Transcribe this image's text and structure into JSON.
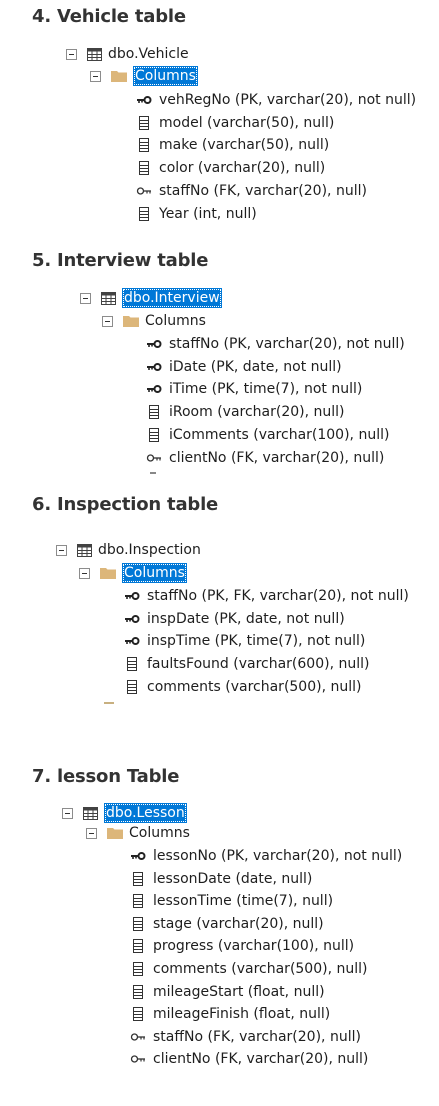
{
  "sections": [
    {
      "heading": "4. Vehicle table",
      "table_label": "dbo.Vehicle",
      "folder_label": "Columns",
      "columns": [
        {
          "icon": "primary-key-icon",
          "label": "vehRegNo (PK, varchar(20), not null)"
        },
        {
          "icon": "column-icon",
          "label": "model (varchar(50), null)"
        },
        {
          "icon": "column-icon",
          "label": "make (varchar(50), null)"
        },
        {
          "icon": "column-icon",
          "label": "color (varchar(20), null)"
        },
        {
          "icon": "foreign-key-icon",
          "label": "staffNo (FK, varchar(20), null)"
        },
        {
          "icon": "column-icon",
          "label": "Year (int, null)"
        }
      ]
    },
    {
      "heading": "5. Interview table",
      "table_label": "dbo.Interview",
      "folder_label": "Columns",
      "columns": [
        {
          "icon": "primary-key-icon",
          "label": "staffNo (PK, varchar(20), not null)"
        },
        {
          "icon": "primary-key-icon",
          "label": "iDate (PK, date, not null)"
        },
        {
          "icon": "primary-key-icon",
          "label": "iTime (PK, time(7), not null)"
        },
        {
          "icon": "column-icon",
          "label": "iRoom (varchar(20), null)"
        },
        {
          "icon": "column-icon",
          "label": "iComments (varchar(100), null)"
        },
        {
          "icon": "foreign-key-icon",
          "label": "clientNo (FK, varchar(20), null)"
        }
      ]
    },
    {
      "heading": "6. Inspection table",
      "table_label": "dbo.Inspection",
      "folder_label": "Columns",
      "columns": [
        {
          "icon": "primary-key-icon",
          "label": "staffNo (PK, FK, varchar(20), not null)"
        },
        {
          "icon": "primary-key-icon",
          "label": "inspDate (PK, date, not null)"
        },
        {
          "icon": "primary-key-icon",
          "label": "inspTime (PK, time(7), not null)"
        },
        {
          "icon": "column-icon",
          "label": "faultsFound (varchar(600), null)"
        },
        {
          "icon": "column-icon",
          "label": "comments (varchar(500), null)"
        }
      ]
    },
    {
      "heading": "7. lesson Table",
      "table_label": "dbo.Lesson",
      "folder_label": "Columns",
      "columns": [
        {
          "icon": "primary-key-icon",
          "label": "lessonNo (PK, varchar(20), not null)"
        },
        {
          "icon": "column-icon",
          "label": "lessonDate (date, null)"
        },
        {
          "icon": "column-icon",
          "label": "lessonTime (time(7), null)"
        },
        {
          "icon": "column-icon",
          "label": "stage (varchar(20), null)"
        },
        {
          "icon": "column-icon",
          "label": "progress (varchar(100), null)"
        },
        {
          "icon": "column-icon",
          "label": "comments (varchar(500), null)"
        },
        {
          "icon": "column-icon",
          "label": "mileageStart (float, null)"
        },
        {
          "icon": "column-icon",
          "label": "mileageFinish (float, null)"
        },
        {
          "icon": "foreign-key-icon",
          "label": "staffNo (FK, varchar(20), null)"
        },
        {
          "icon": "foreign-key-icon",
          "label": "clientNo (FK, varchar(20), null)"
        }
      ]
    }
  ],
  "colors": {
    "selection_bg": "#0078d7",
    "selection_text": "#ffffff",
    "folder": "#dcb67a",
    "heading": "#333333"
  }
}
